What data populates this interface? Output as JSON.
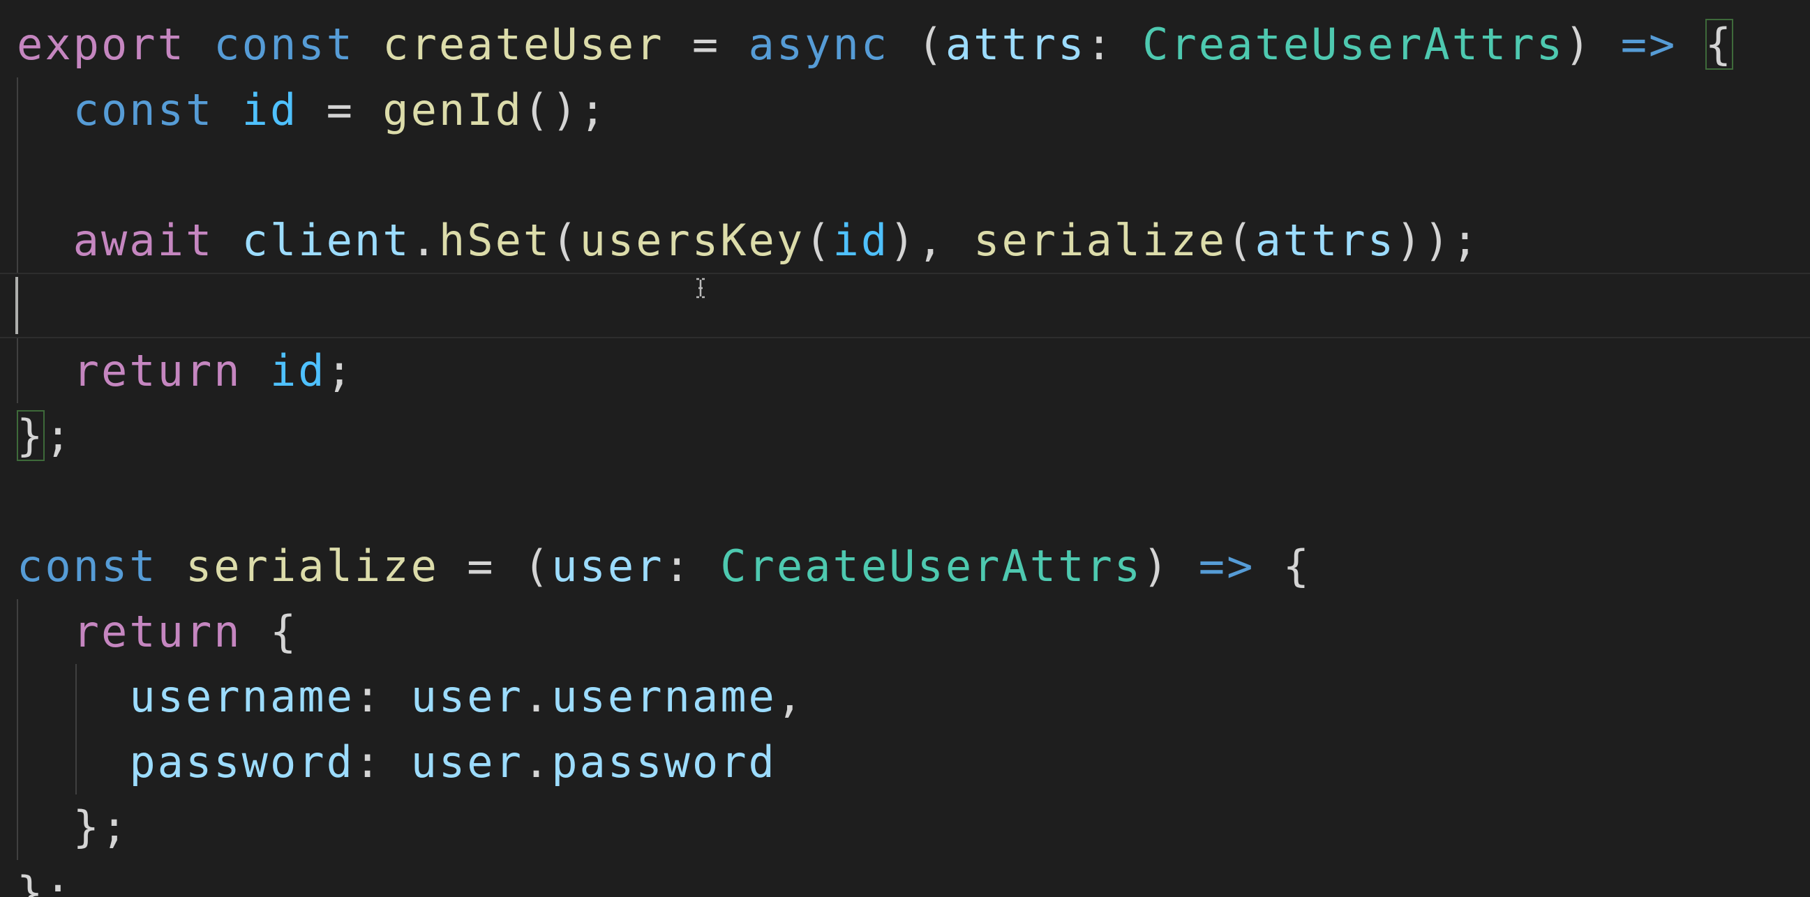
{
  "editor": {
    "lines": [
      {
        "tokens": [
          {
            "text": "export ",
            "kind": "keyword"
          },
          {
            "text": "const ",
            "kind": "storage"
          },
          {
            "text": "createUser",
            "kind": "function"
          },
          {
            "text": " = ",
            "kind": "punct"
          },
          {
            "text": "async ",
            "kind": "storage"
          },
          {
            "text": "(",
            "kind": "punct"
          },
          {
            "text": "attrs",
            "kind": "param"
          },
          {
            "text": ": ",
            "kind": "punct"
          },
          {
            "text": "CreateUserAttrs",
            "kind": "type"
          },
          {
            "text": ") ",
            "kind": "punct"
          },
          {
            "text": "=>",
            "kind": "storage"
          },
          {
            "text": " ",
            "kind": "punct"
          },
          {
            "text": "{",
            "kind": "punct-bracket-match"
          }
        ]
      },
      {
        "tokens": [
          {
            "text": "  ",
            "kind": "punct"
          },
          {
            "text": "const ",
            "kind": "storage"
          },
          {
            "text": "id",
            "kind": "variable"
          },
          {
            "text": " = ",
            "kind": "punct"
          },
          {
            "text": "genId",
            "kind": "function"
          },
          {
            "text": "();",
            "kind": "punct"
          }
        ]
      },
      {
        "tokens": []
      },
      {
        "tokens": [
          {
            "text": "  ",
            "kind": "punct"
          },
          {
            "text": "await ",
            "kind": "keyword"
          },
          {
            "text": "client",
            "kind": "param"
          },
          {
            "text": ".",
            "kind": "punct"
          },
          {
            "text": "hSet",
            "kind": "function"
          },
          {
            "text": "(",
            "kind": "punct"
          },
          {
            "text": "usersKey",
            "kind": "function"
          },
          {
            "text": "(",
            "kind": "punct"
          },
          {
            "text": "id",
            "kind": "variable"
          },
          {
            "text": "), ",
            "kind": "punct"
          },
          {
            "text": "serialize",
            "kind": "function"
          },
          {
            "text": "(",
            "kind": "punct"
          },
          {
            "text": "attrs",
            "kind": "param"
          },
          {
            "text": "));",
            "kind": "punct"
          }
        ]
      },
      {
        "tokens": [],
        "current": true
      },
      {
        "tokens": [
          {
            "text": "  ",
            "kind": "punct"
          },
          {
            "text": "return ",
            "kind": "keyword"
          },
          {
            "text": "id",
            "kind": "variable"
          },
          {
            "text": ";",
            "kind": "punct"
          }
        ]
      },
      {
        "tokens": [
          {
            "text": "}",
            "kind": "punct-bracket-match"
          },
          {
            "text": ";",
            "kind": "punct"
          }
        ]
      },
      {
        "tokens": []
      },
      {
        "tokens": [
          {
            "text": "const ",
            "kind": "storage"
          },
          {
            "text": "serialize",
            "kind": "function"
          },
          {
            "text": " = (",
            "kind": "punct"
          },
          {
            "text": "user",
            "kind": "param"
          },
          {
            "text": ": ",
            "kind": "punct"
          },
          {
            "text": "CreateUserAttrs",
            "kind": "type"
          },
          {
            "text": ") ",
            "kind": "punct"
          },
          {
            "text": "=>",
            "kind": "storage"
          },
          {
            "text": " {",
            "kind": "punct"
          }
        ]
      },
      {
        "tokens": [
          {
            "text": "  ",
            "kind": "punct"
          },
          {
            "text": "return ",
            "kind": "keyword"
          },
          {
            "text": "{",
            "kind": "punct"
          }
        ]
      },
      {
        "tokens": [
          {
            "text": "    ",
            "kind": "punct"
          },
          {
            "text": "username",
            "kind": "param"
          },
          {
            "text": ": ",
            "kind": "punct"
          },
          {
            "text": "user",
            "kind": "param"
          },
          {
            "text": ".",
            "kind": "punct"
          },
          {
            "text": "username",
            "kind": "param"
          },
          {
            "text": ",",
            "kind": "punct"
          }
        ]
      },
      {
        "tokens": [
          {
            "text": "    ",
            "kind": "punct"
          },
          {
            "text": "password",
            "kind": "param"
          },
          {
            "text": ": ",
            "kind": "punct"
          },
          {
            "text": "user",
            "kind": "param"
          },
          {
            "text": ".",
            "kind": "punct"
          },
          {
            "text": "password",
            "kind": "param"
          }
        ]
      },
      {
        "tokens": [
          {
            "text": "  ",
            "kind": "punct"
          },
          {
            "text": "};",
            "kind": "punct"
          }
        ]
      },
      {
        "tokens": [
          {
            "text": "};",
            "kind": "punct"
          }
        ]
      }
    ]
  },
  "colors": {
    "background": "#1e1e1e",
    "keyword": "#c586c0",
    "storage": "#569cd6",
    "function": "#dcdcaa",
    "variable": "#4fc1ff",
    "param": "#9cdcfe",
    "type": "#4ec9b0",
    "punct": "#d4d4d4"
  },
  "icons": {
    "mouse_pointer": "text-ibeam-cursor-icon"
  }
}
